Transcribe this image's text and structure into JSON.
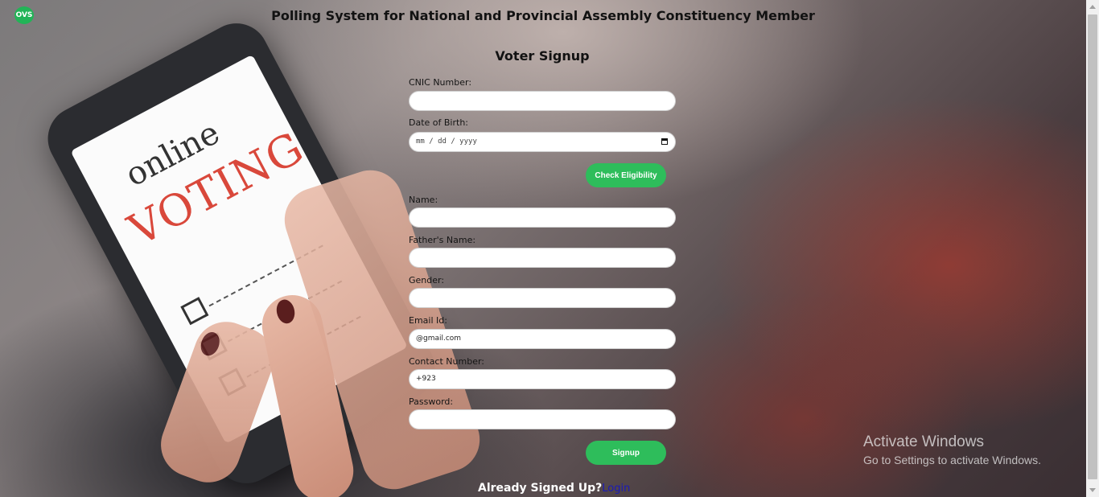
{
  "header": {
    "logo_text": "OVS",
    "title": "Polling System for National and Provincial Assembly Constituency Member"
  },
  "background_image": {
    "online_text": "online",
    "voting_text": "VOTING"
  },
  "form": {
    "title": "Voter Signup",
    "cnic": {
      "label": "CNIC Number:",
      "value": ""
    },
    "dob": {
      "label": "Date of Birth:",
      "placeholder": "mm / dd / yyyy"
    },
    "check_button": "Check Eligibility",
    "name": {
      "label": "Name:",
      "value": ""
    },
    "father_name": {
      "label": "Father's Name:",
      "value": ""
    },
    "gender": {
      "label": "Gender:",
      "value": ""
    },
    "email": {
      "label": "Email Id:",
      "value": "@gmail.com"
    },
    "contact": {
      "label": "Contact Number:",
      "value": "+923"
    },
    "password": {
      "label": "Password:",
      "value": ""
    },
    "signup_button": "Signup"
  },
  "footer": {
    "text": "Already Signed Up?",
    "login_link": "Login"
  },
  "watermark": {
    "line1": "Activate Windows",
    "line2": "Go to Settings to activate Windows."
  },
  "colors": {
    "accent": "#2ebd5b",
    "link": "#1a1ab8"
  }
}
